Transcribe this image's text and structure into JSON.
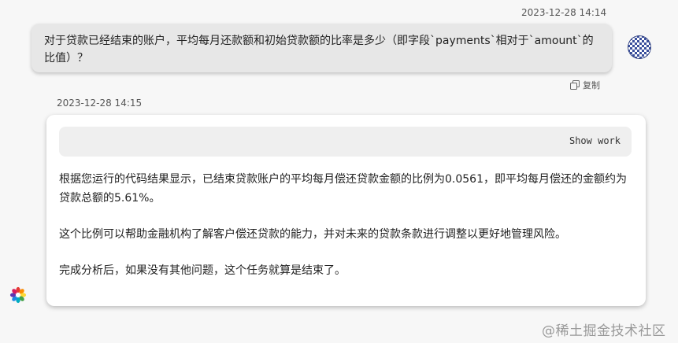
{
  "user_message": {
    "timestamp": "2023-12-28 14:14",
    "text": "对于贷款已经结束的账户，平均每月还款额和初始贷款额的比率是多少（即字段`payments`相对于`amount`的比值）？",
    "copy_label": "复制",
    "copy_icon": "copy-icon",
    "avatar_icon": "user-avatar"
  },
  "bot_message": {
    "timestamp": "2023-12-28 14:15",
    "show_work_label": "Show work",
    "paragraphs": [
      "根据您运行的代码结果显示，已结束贷款账户的平均每月偿还贷款金额的比例为0.0561，即平均每月偿还的金额约为贷款总额的5.61%。",
      "这个比例可以帮助金融机构了解客户偿还贷款的能力，并对未来的贷款条款进行调整以更好地管理风险。",
      "完成分析后，如果没有其他问题，这个任务就算是结束了。"
    ],
    "avatar_icon": "assistant-logo"
  },
  "watermark": "@稀土掘金技术社区",
  "colors": {
    "page_bg": "#f7f7f7",
    "user_bubble_bg": "#e7e7e7",
    "card_bg": "#ffffff",
    "show_work_bg": "#efefef",
    "avatar_blue": "#3a4f9c"
  }
}
